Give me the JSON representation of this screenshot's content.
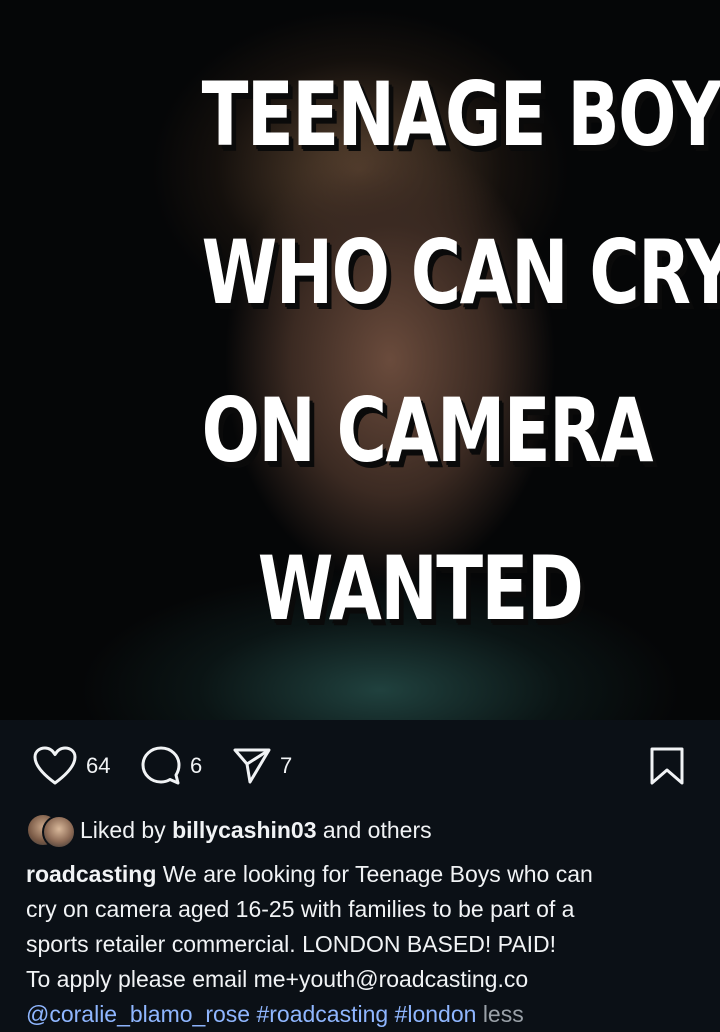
{
  "post": {
    "headline": [
      "TEENAGE BOYS",
      "WHO CAN CRY",
      "ON CAMERA",
      "WANTED"
    ]
  },
  "actions": {
    "likes": "64",
    "comments": "6",
    "shares": "7"
  },
  "liked_by": {
    "prefix": "Liked by",
    "user": "billycashin03",
    "suffix": "and others"
  },
  "caption": {
    "username": "roadcasting",
    "line1": "We are looking for Teenage Boys who can",
    "line2": "cry on camera aged 16-25 with families to be part of a",
    "line3": "sports retailer commercial. LONDON BASED! PAID!",
    "line4": "To apply please email me+youth@roadcasting.co",
    "mention": "@coralie_blamo_rose",
    "tag1": "#roadcasting",
    "tag2": "#london",
    "less": "less"
  },
  "colors": {
    "background": "#0b1016",
    "link": "#8fb6ff",
    "muted": "#9aa1a8"
  },
  "icons": [
    "heart-icon",
    "comment-icon",
    "share-icon",
    "bookmark-icon"
  ]
}
